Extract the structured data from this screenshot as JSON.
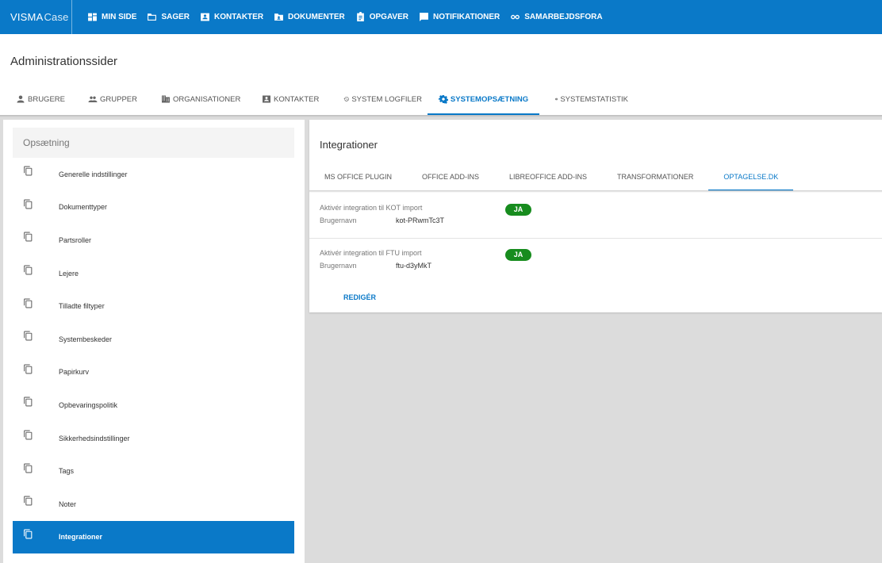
{
  "app": {
    "brand": "VISMA",
    "product": "Case"
  },
  "nav": {
    "items": [
      {
        "label": "MIN SIDE",
        "icon": "dashboard-icon"
      },
      {
        "label": "SAGER",
        "icon": "folder-icon"
      },
      {
        "label": "KONTAKTER",
        "icon": "contact-card-icon"
      },
      {
        "label": "DOKUMENTER",
        "icon": "document-folder-icon"
      },
      {
        "label": "OPGAVER",
        "icon": "clipboard-icon"
      },
      {
        "label": "NOTIFIKATIONER",
        "icon": "message-icon"
      },
      {
        "label": "SAMARBEJDSFORA",
        "icon": "link-icon"
      }
    ]
  },
  "header": {
    "title": "Administrationssider",
    "tabs": [
      {
        "label": "BRUGERE",
        "icon": "person-icon"
      },
      {
        "label": "GRUPPER",
        "icon": "group-icon"
      },
      {
        "label": "ORGANISATIONER",
        "icon": "building-icon"
      },
      {
        "label": "KONTAKTER",
        "icon": "contact-card-icon"
      },
      {
        "label": "SYSTEM LOGFILER",
        "icon": "history-icon"
      },
      {
        "label": "SYSTEMOPSÆTNING",
        "icon": "gear-icon",
        "active": true
      },
      {
        "label": "SYSTEMSTATISTIK",
        "icon": "pie-chart-icon"
      }
    ]
  },
  "sidebar": {
    "header": "Opsætning",
    "items": [
      {
        "label": "Generelle indstillinger"
      },
      {
        "label": "Dokumenttyper"
      },
      {
        "label": "Partsroller"
      },
      {
        "label": "Lejere"
      },
      {
        "label": "Tilladte filtyper"
      },
      {
        "label": "Systembeskeder"
      },
      {
        "label": "Papirkurv"
      },
      {
        "label": "Opbevaringspolitik"
      },
      {
        "label": "Sikkerhedsindstillinger"
      },
      {
        "label": "Tags"
      },
      {
        "label": "Noter"
      },
      {
        "label": "Integrationer",
        "active": true
      }
    ]
  },
  "panel": {
    "title": "Integrationer",
    "tabs": [
      {
        "label": "MS OFFICE PLUGIN"
      },
      {
        "label": "OFFICE ADD-INS"
      },
      {
        "label": "LIBREOFFICE ADD-INS"
      },
      {
        "label": "TRANSFORMATIONER"
      },
      {
        "label": "OPTAGELSE.DK",
        "active": true
      }
    ],
    "rows": [
      {
        "label": "Aktivér integration til KOT import",
        "status": "JA",
        "user_label": "Brugernavn",
        "user_value": "kot-PRwmTc3T"
      },
      {
        "label": "Aktivér integration til FTU import",
        "status": "JA",
        "user_label": "Brugernavn",
        "user_value": "ftu-d3yMkT"
      }
    ],
    "edit_label": "REDIGÉR"
  },
  "colors": {
    "accent": "#0a79c8",
    "success": "#178c1e"
  }
}
